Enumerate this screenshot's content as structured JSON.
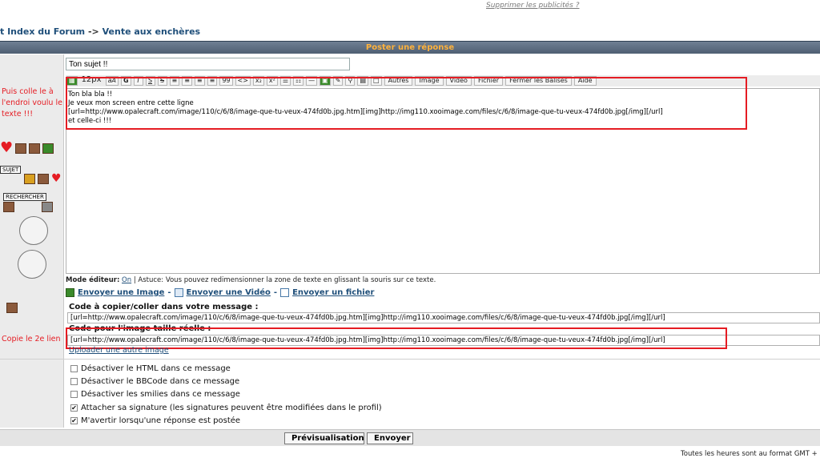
{
  "ads": {
    "remove": "Supprimer les publicités ?"
  },
  "breadcrumb": {
    "index": "t Index du Forum",
    "sep": " -> ",
    "current": "Vente aux enchères"
  },
  "header": {
    "title": "Poster une réponse"
  },
  "subject": {
    "value": "Ton sujet !!"
  },
  "toolbar": {
    "font_size": "12px",
    "bold": "G",
    "italic": "I",
    "underline": "S",
    "strike": "S",
    "quote": "99",
    "code": "<>",
    "sub": "x₂",
    "sup": "x²",
    "others": "Autres",
    "image": "Image",
    "video": "Vidéo",
    "file": "Fichier",
    "close_tags": "Fermer les Balises",
    "help": "Aide"
  },
  "editor": {
    "lines": [
      "Ton bla bla !!",
      "Je veux mon screen entre cette ligne",
      "[url=http://www.opalecraft.com/image/110/c/6/8/image-que-tu-veux-474fd0b.jpg.htm][img]http://img110.xooimage.com/files/c/6/8/image-que-tu-veux-474fd0b.jpg[/img][/url]",
      "et celle-ci !!!"
    ]
  },
  "annotations": {
    "paste_note": "Puis colle le à l'endroi voulu le texte !!!",
    "copy_note": "Copie le 2e lien"
  },
  "smilies": {
    "tag_sujet": "SUJET",
    "tag_rechercher": "RECHERCHER"
  },
  "editor_mode": {
    "label": "Mode éditeur:",
    "mode": "On",
    "tip": " | Astuce: Vous pouvez redimensionner la zone de texte en glissant la souris sur ce texte."
  },
  "upload": {
    "send_image": "Envoyer une Image",
    "send_video": "Envoyer une Vidéo",
    "send_file": "Envoyer un fichier",
    "dash": " - "
  },
  "codes": {
    "copy_label": "Code à copier/coller dans votre message :",
    "copy_value": "[url=http://www.opalecraft.com/image/110/c/6/8/image-que-tu-veux-474fd0b.jpg.htm][img]http://img110.xooimage.com/files/c/6/8/image-que-tu-veux-474fd0b.jpg[/img][/url]",
    "real_label": "Code pour l'image taille réelle :",
    "real_value": "[url=http://www.opalecraft.com/image/110/c/6/8/image-que-tu-veux-474fd0b.jpg.htm][img]http://img110.xooimage.com/files/c/6/8/image-que-tu-veux-474fd0b.jpg[/img][/url]",
    "upload_another": "Uploader une autre image"
  },
  "options": [
    {
      "label": "Désactiver le HTML dans ce message",
      "checked": false
    },
    {
      "label": "Désactiver le BBCode dans ce message",
      "checked": false
    },
    {
      "label": "Désactiver les smilies dans ce message",
      "checked": false
    },
    {
      "label": "Attacher sa signature (les signatures peuvent être modifiées dans le profil)",
      "checked": true
    },
    {
      "label": "M'avertir lorsqu'une réponse est postée",
      "checked": true
    }
  ],
  "actions": {
    "preview": "Prévisualisation",
    "submit": "Envoyer"
  },
  "footer": {
    "timezone": "Toutes les heures sont au format GMT +"
  },
  "colors": {
    "annotation": "#e51c23",
    "link": "#1f4f7a",
    "header_text": "#ffb23c"
  }
}
